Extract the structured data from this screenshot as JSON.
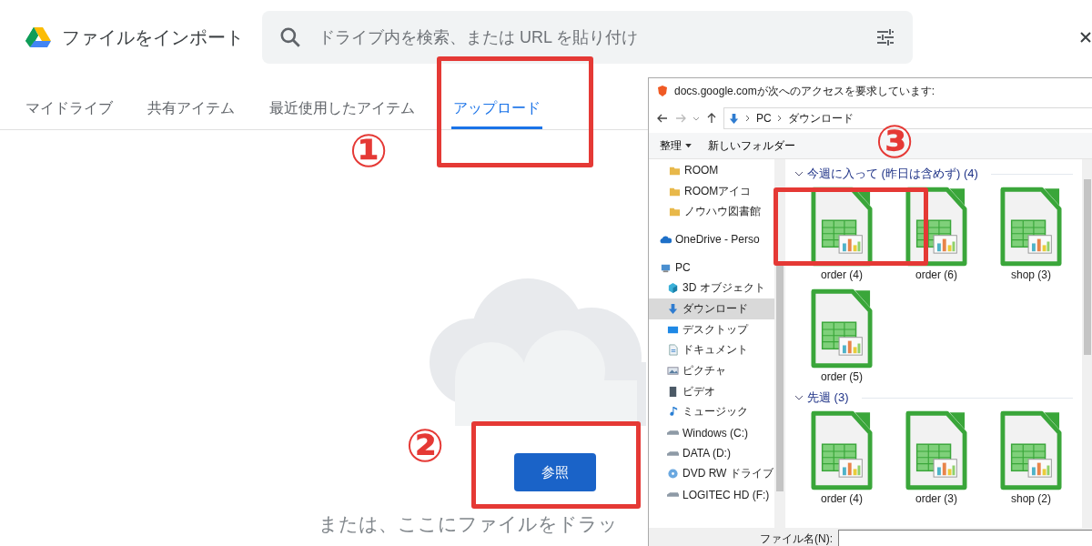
{
  "app": {
    "title": "ファイルをインポート",
    "search_placeholder": "ドライブ内を検索、または URL を貼り付け"
  },
  "tabs": [
    {
      "label": "マイドライブ",
      "selected": false
    },
    {
      "label": "共有アイテム",
      "selected": false
    },
    {
      "label": "最近使用したアイテム",
      "selected": false
    },
    {
      "label": "アップロード",
      "selected": true
    }
  ],
  "upload": {
    "button": "参照",
    "drop_hint": "または、ここにファイルをドラッ"
  },
  "dialog": {
    "title": "docs.google.comが次へのアクセスを要求しています:",
    "path": [
      "PC",
      "ダウンロード"
    ],
    "toolbar": [
      {
        "label": "整理",
        "kind": "menu"
      },
      {
        "label": "新しいフォルダー",
        "kind": "button"
      }
    ],
    "nav": [
      {
        "label": "ROOM",
        "kind": "folder",
        "selected": false
      },
      {
        "label": "ROOMアイコ",
        "kind": "folder",
        "selected": false
      },
      {
        "label": "ノウハウ図書館",
        "kind": "folder",
        "selected": false
      },
      {
        "label": "OneDrive - Perso",
        "kind": "cloud",
        "selected": false
      },
      {
        "label": "PC",
        "kind": "pc",
        "selected": false,
        "children": [
          {
            "label": "3D オブジェクト",
            "kind": "cube",
            "selected": false
          },
          {
            "label": "ダウンロード",
            "kind": "download",
            "selected": true
          },
          {
            "label": "デスクトップ",
            "kind": "desktop",
            "selected": false
          },
          {
            "label": "ドキュメント",
            "kind": "document",
            "selected": false
          },
          {
            "label": "ピクチャ",
            "kind": "picture",
            "selected": false
          },
          {
            "label": "ビデオ",
            "kind": "video",
            "selected": false
          },
          {
            "label": "ミュージック",
            "kind": "music",
            "selected": false
          },
          {
            "label": "Windows (C:)",
            "kind": "drive",
            "selected": false
          },
          {
            "label": "DATA (D:)",
            "kind": "drive",
            "selected": false
          },
          {
            "label": "DVD RW ドライブ",
            "kind": "dvd",
            "selected": false
          },
          {
            "label": "LOGITEC HD (F:)",
            "kind": "drive",
            "selected": false
          }
        ]
      }
    ],
    "groups": [
      {
        "title": "今週に入って (昨日は含めず) (4)",
        "files": [
          "order (4)",
          "order (6)",
          "shop (3)",
          "order (5)"
        ]
      },
      {
        "title": "先週 (3)",
        "files": [
          "order (4)",
          "order (3)",
          "shop (2)"
        ]
      }
    ],
    "filename_label": "ファイル名(N):"
  },
  "annotations": [
    {
      "label": "①"
    },
    {
      "label": "②"
    },
    {
      "label": "③"
    }
  ]
}
